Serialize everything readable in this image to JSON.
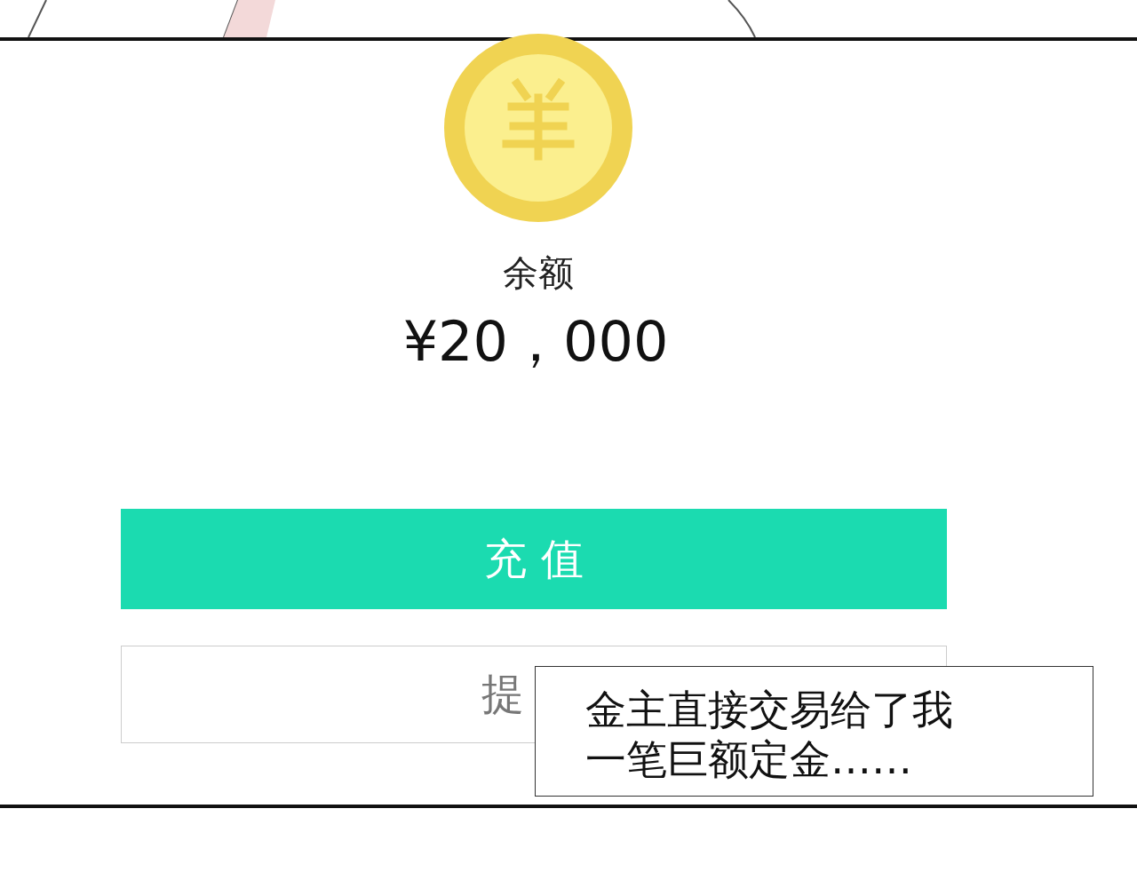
{
  "balance": {
    "label": "余额",
    "amount": "¥20，000"
  },
  "buttons": [
    {
      "kind": "primary",
      "label": "充 值"
    },
    {
      "kind": "secondary",
      "label": "提"
    }
  ],
  "caption": {
    "lines": [
      "金主直接交易给了我",
      "一笔巨额定金……"
    ]
  }
}
